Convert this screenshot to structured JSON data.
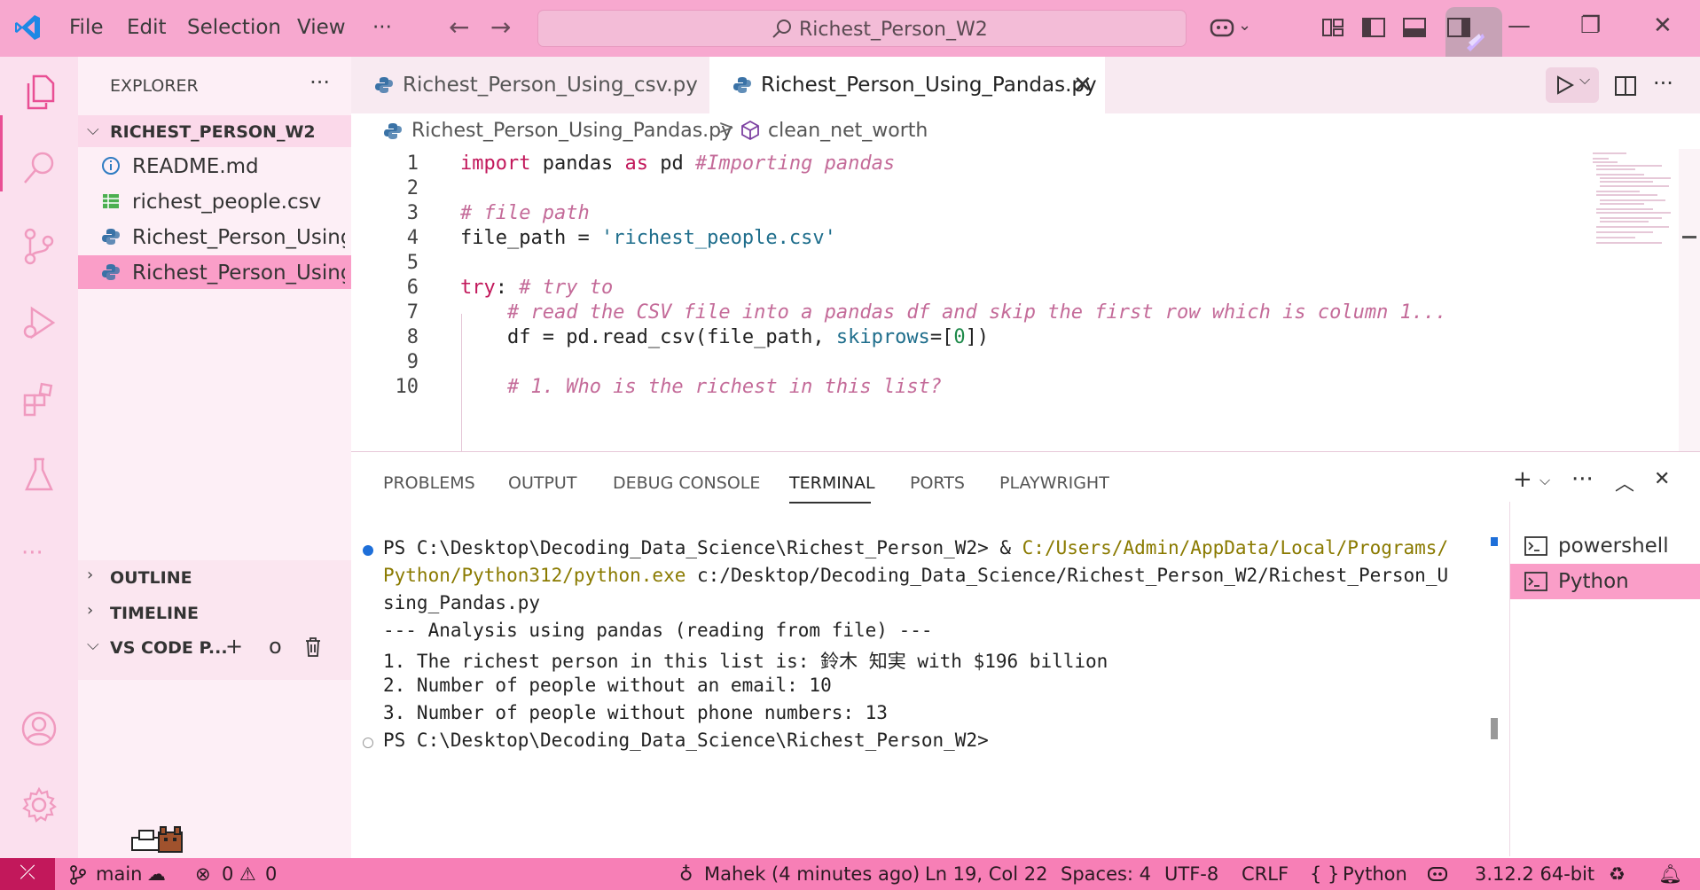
{
  "titlebar": {
    "menu": [
      "File",
      "Edit",
      "Selection",
      "View",
      "···"
    ],
    "search": "Richest_Person_W2"
  },
  "explorer": {
    "title": "EXPLORER",
    "more": "···",
    "folder": "RICHEST_PERSON_W2",
    "files": [
      {
        "label": "README.md",
        "icon": "info-icon"
      },
      {
        "label": "richest_people.csv",
        "icon": "csv-icon"
      },
      {
        "label": "Richest_Person_Using...",
        "icon": "python-icon"
      },
      {
        "label": "Richest_Person_Using...",
        "icon": "python-icon",
        "selected": true
      }
    ],
    "sections": [
      "OUTLINE",
      "TIMELINE",
      "VS CODE P..."
    ],
    "vscode_p_actions": [
      "+",
      "o"
    ]
  },
  "tabs": [
    {
      "label": "Richest_Person_Using_csv.py",
      "active": false
    },
    {
      "label": "Richest_Person_Using_Pandas.py",
      "active": true,
      "close": "✕"
    }
  ],
  "breadcrumb": {
    "file": "Richest_Person_Using_Pandas.py",
    "separator": ">",
    "symbol": "clean_net_worth"
  },
  "code": {
    "line_numbers": [
      "1",
      "2",
      "3",
      "4",
      "5",
      "6",
      "7",
      "8",
      "9",
      "10"
    ],
    "lines": {
      "l1": {
        "kw1": "import",
        "t1": " pandas ",
        "kw2": "as",
        "t2": " pd ",
        "cm": "#Importing pandas"
      },
      "l3": {
        "cm": "# file path"
      },
      "l4": {
        "t1": "file_path = ",
        "st": "'richest_people.csv'"
      },
      "l6": {
        "kw": "try",
        "t1": ": ",
        "cm": "# try to"
      },
      "l7": {
        "cm": "    # read the CSV file into a pandas df and skip the first row which is column 1..."
      },
      "l8": {
        "t1": "    df = pd.read_csv(file_path, ",
        "kw": "skiprows",
        "t2": "=[",
        "num": "0",
        "t3": "])"
      },
      "l10": {
        "cm": "    # 1. Who is the richest in this list?"
      }
    }
  },
  "panel": {
    "tabs": [
      "PROBLEMS",
      "OUTPUT",
      "DEBUG CONSOLE",
      "TERMINAL",
      "PORTS",
      "PLAYWRIGHT"
    ],
    "active_tab": "TERMINAL",
    "terminal": {
      "l1a": "PS C:\\Desktop\\Decoding_Data_Science\\Richest_Person_W2> & ",
      "l1b": "C:/Users/Admin/AppData/Local/Programs/",
      "l2a": "Python/Python312/python.exe",
      "l2b": " c:/Desktop/Decoding_Data_Science/Richest_Person_W2/Richest_Person_U",
      "l3": "sing_Pandas.py",
      "l4": "--- Analysis using pandas (reading from file) ---",
      "l5": "1. The richest person in this list is: 鈴木 知実 with $196 billion",
      "l6": "2. Number of people without an email: 10",
      "l7": "3. Number of people without phone numbers: 13",
      "l8": "PS C:\\Desktop\\Decoding_Data_Science\\Richest_Person_W2>"
    },
    "terminals": [
      {
        "label": "powershell",
        "active": false
      },
      {
        "label": "Python",
        "active": true
      }
    ]
  },
  "statusbar": {
    "remote": "⤫",
    "branch": "main",
    "errors": "0",
    "warnings": "0",
    "blame": "Mahek (4 minutes ago)",
    "position": "Ln 19, Col 22",
    "spaces": "Spaces: 4",
    "encoding": "UTF-8",
    "eol": "CRLF",
    "language": "Python",
    "interpreter": "3.12.2 64-bit"
  },
  "colors": {
    "titlebar": "#f7a8cf",
    "activity": "#fbe0ee",
    "sidebar": "#fdeff6",
    "selection": "#fa9ec8",
    "statusbar": "#f77fb6",
    "keyword": "#c2185b",
    "comment": "#c46b99",
    "string": "#1f6e8c"
  }
}
